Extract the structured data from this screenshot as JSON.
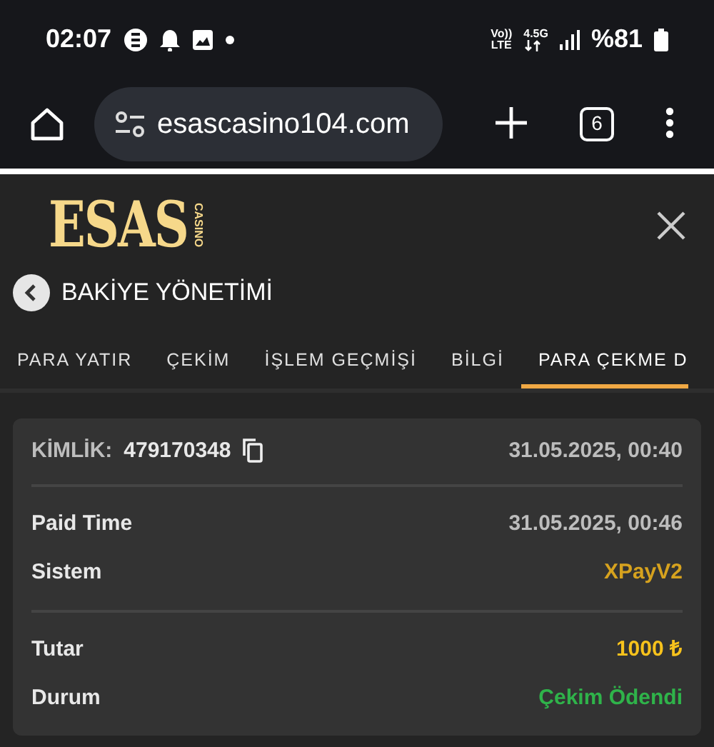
{
  "status_bar": {
    "time": "02:07",
    "network_top": "Vo))",
    "network_bottom": "LTE",
    "data_type": "4.5G",
    "battery": "%81"
  },
  "browser": {
    "url": "esascasino104.com",
    "tab_count": "6"
  },
  "logo": {
    "main": "ESAS",
    "sub": "CASINO"
  },
  "page_title": "BAKİYE YÖNETİMİ",
  "tabs": [
    {
      "label": "PARA YATIR",
      "selected": false
    },
    {
      "label": "ÇEKİM",
      "selected": false
    },
    {
      "label": "İŞLEM GEÇMİŞİ",
      "selected": false
    },
    {
      "label": "BİLGİ",
      "selected": false
    },
    {
      "label": "PARA ÇEKME D",
      "selected": true
    }
  ],
  "transaction": {
    "id_label": "KİMLİK:",
    "id": "479170348",
    "created": "31.05.2025, 00:40",
    "sections": [
      [
        {
          "label": "Paid Time",
          "value": "31.05.2025, 00:46",
          "color": "#bdbdbd"
        },
        {
          "label": "Sistem",
          "value": "XPayV2",
          "color": "#d6a21e"
        }
      ],
      [
        {
          "label": "Tutar",
          "value": "1000 ₺",
          "color": "#f7c21c"
        },
        {
          "label": "Durum",
          "value": "Çekim Ödendi",
          "color": "#2fb34a"
        }
      ]
    ]
  }
}
